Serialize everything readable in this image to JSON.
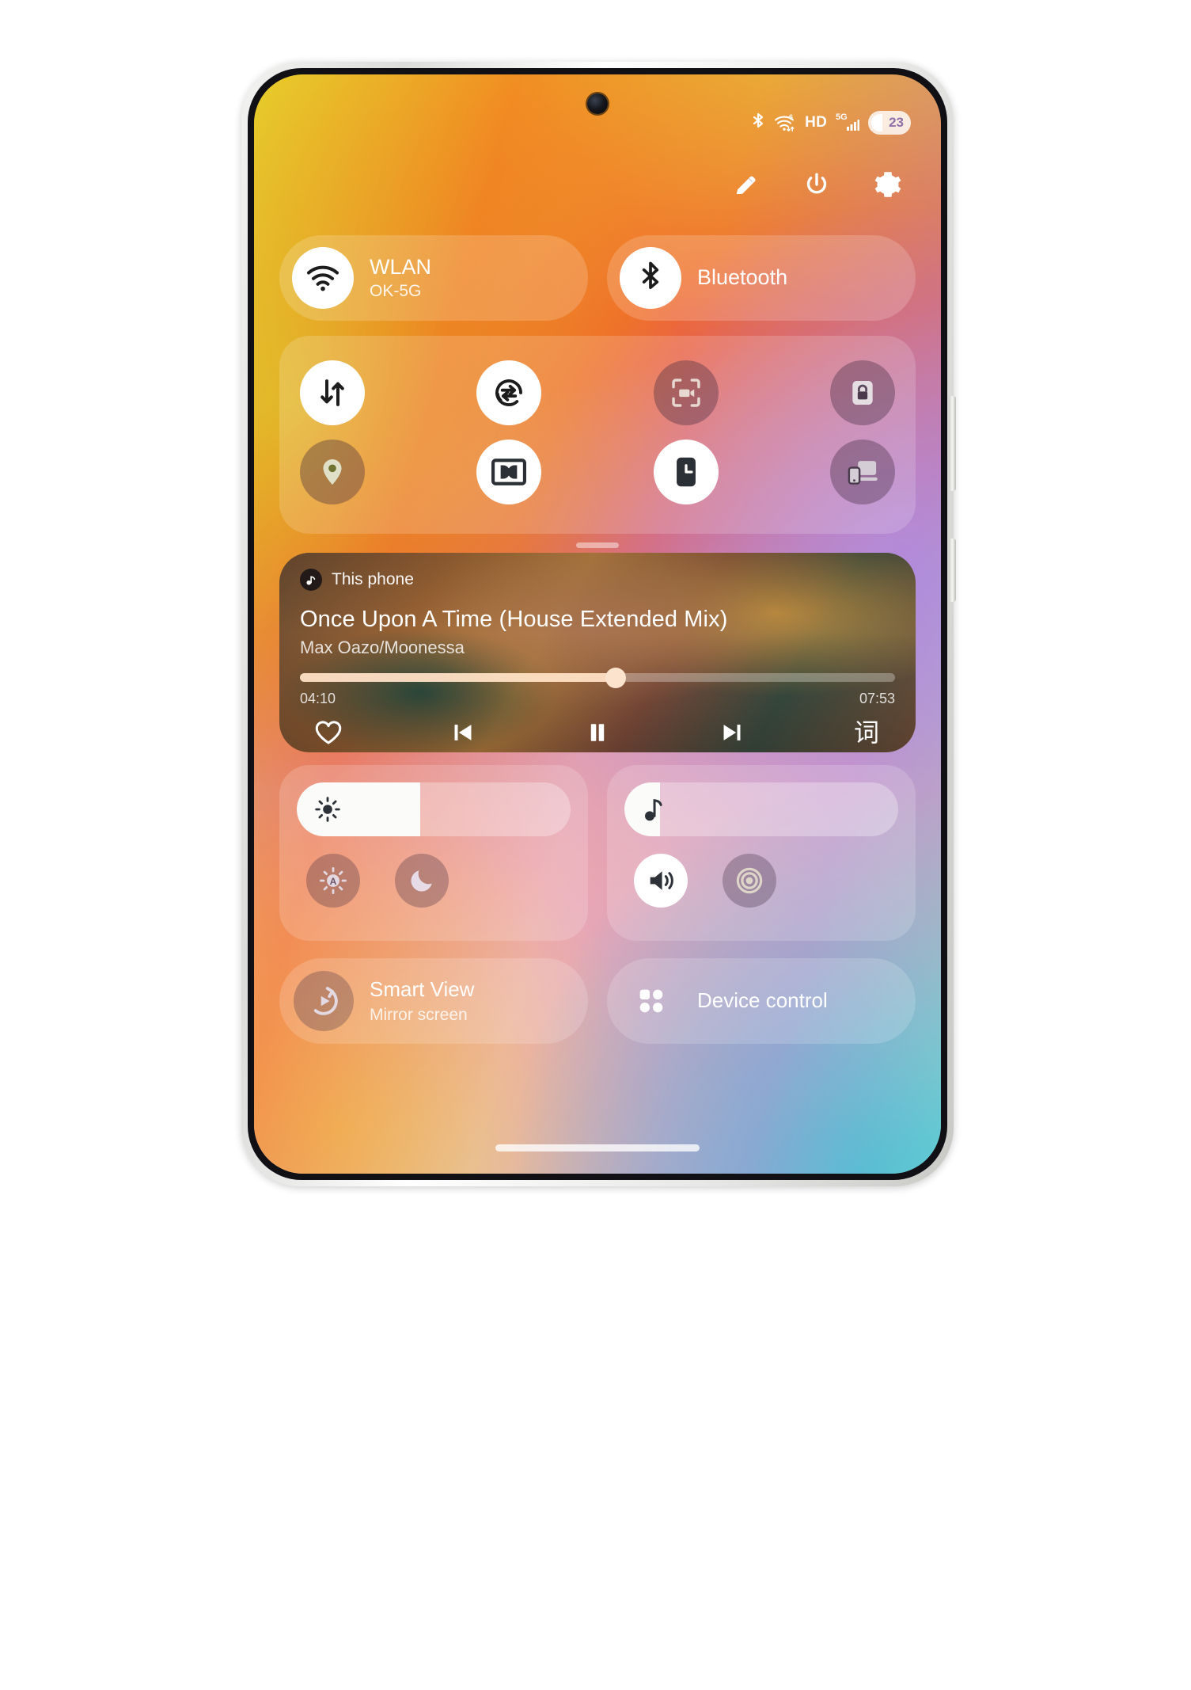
{
  "statusbar": {
    "bluetooth_icon": "bluetooth-icon",
    "wifi_icon": "wifi-6-icon",
    "wifi_badge": "6",
    "hd_label": "HD",
    "network_label": "5G",
    "signal_icon": "signal-bars-icon",
    "battery_level": "23"
  },
  "header": {
    "edit_icon": "pencil-icon",
    "power_icon": "power-icon",
    "settings_icon": "gear-icon"
  },
  "connectivity": [
    {
      "name": "wlan",
      "icon": "wifi-icon",
      "title": "WLAN",
      "subtitle": "OK-5G",
      "state": "on"
    },
    {
      "name": "bluetooth",
      "icon": "bluetooth-icon",
      "title": "Bluetooth",
      "subtitle": "",
      "state": "on"
    }
  ],
  "toggles": {
    "row1": [
      {
        "name": "mobile-data",
        "icon": "data-transfer-icon",
        "state": "on"
      },
      {
        "name": "auto-sync",
        "icon": "sync-rotate-icon",
        "state": "on"
      },
      {
        "name": "screen-record",
        "icon": "screen-record-icon",
        "state": "off"
      },
      {
        "name": "screen-lock",
        "icon": "lock-icon",
        "state": "off"
      }
    ],
    "row2": [
      {
        "name": "location",
        "icon": "location-pin-icon",
        "state": "off"
      },
      {
        "name": "dolby-atmos",
        "icon": "dolby-icon",
        "state": "on"
      },
      {
        "name": "always-on-display",
        "icon": "clock-icon",
        "state": "on"
      },
      {
        "name": "cast-devices",
        "icon": "multi-device-icon",
        "state": "off"
      }
    ]
  },
  "media": {
    "source_icon": "music-app-icon",
    "source_label": "This phone",
    "title": "Once Upon A Time (House Extended Mix)",
    "artist": "Max Oazo/Moonessa",
    "elapsed": "04:10",
    "duration": "07:53",
    "progress_percent": 53,
    "controls": [
      {
        "name": "favorite-button",
        "icon": "heart-icon"
      },
      {
        "name": "previous-button",
        "icon": "skip-previous-icon"
      },
      {
        "name": "pause-button",
        "icon": "pause-icon"
      },
      {
        "name": "next-button",
        "icon": "skip-next-icon"
      },
      {
        "name": "lyrics-button",
        "icon": "lyrics-icon",
        "glyph": "词"
      }
    ]
  },
  "brightness": {
    "slider_name": "brightness-slider",
    "icon": "brightness-sun-icon",
    "value_percent": 45,
    "buttons": [
      {
        "name": "auto-brightness-button",
        "icon": "auto-brightness-icon",
        "state": "off"
      },
      {
        "name": "dark-mode-button",
        "icon": "moon-icon",
        "state": "off"
      }
    ]
  },
  "volume": {
    "slider_name": "media-volume-slider",
    "icon": "music-note-icon",
    "value_percent": 13,
    "buttons": [
      {
        "name": "sound-mode-button",
        "icon": "speaker-icon",
        "state": "on"
      },
      {
        "name": "vibration-button",
        "icon": "vibrate-rings-icon",
        "state": "off"
      }
    ]
  },
  "bottom": [
    {
      "name": "smart-view",
      "icon": "smart-view-icon",
      "title": "Smart View",
      "subtitle": "Mirror screen"
    },
    {
      "name": "device-control",
      "icon": "grid-dots-icon",
      "title": "Device control",
      "subtitle": ""
    }
  ],
  "colors": {
    "accent_seek": "#fbe3cd",
    "panel_bg": "rgba(255,255,255,0.17)",
    "active_tile": "#ffffff"
  }
}
